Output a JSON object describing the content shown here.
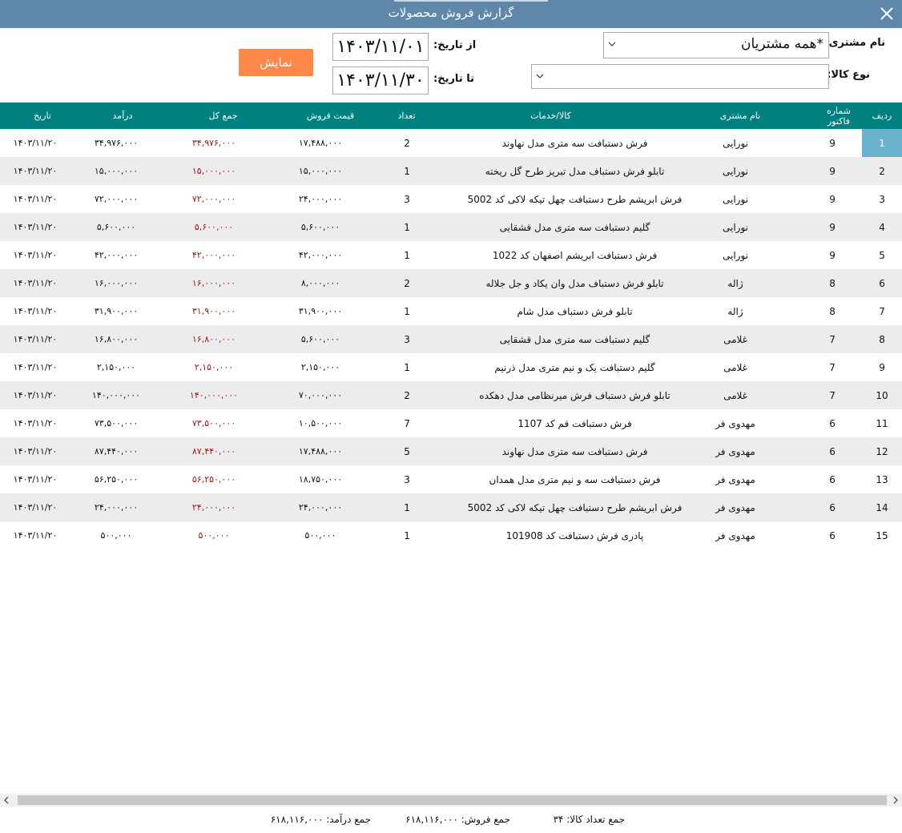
{
  "window": {
    "title": "گزارش فروش محصولات"
  },
  "filters": {
    "customer_label": "نام مشتری:",
    "customer_value": "*همه مشتریان",
    "product_type_label": "نوع کالا:",
    "product_type_value": "",
    "from_label": "از تاریخ:",
    "from_value": "۱۴۰۳/۱۱/۰۱",
    "to_label": "تا تاریخ:",
    "to_value": "۱۴۰۳/۱۱/۳۰",
    "show_button": "نمایش"
  },
  "columns": {
    "row": "ردیف",
    "invoice": "شماره فاکتور",
    "customer": "نام مشتری",
    "product": "کالا/خدمات",
    "qty": "تعداد",
    "price": "قیمت فروش",
    "total": "جمع کل",
    "income": "درآمد",
    "date": "تاریخ"
  },
  "rows": [
    {
      "row": "1",
      "invoice": "9",
      "customer": "نورایی",
      "product": "فرش دستبافت سه متری مدل نهاوند",
      "qty": "2",
      "price": "۱۷,۴۸۸,۰۰۰",
      "total": "۳۴,۹۷۶,۰۰۰",
      "income": "۳۴,۹۷۶,۰۰۰",
      "date": "۱۴۰۳/۱۱/۲۰"
    },
    {
      "row": "2",
      "invoice": "9",
      "customer": "نورایی",
      "product": "تابلو فرش دستباف مدل تبریز طرح گل ریخته",
      "qty": "1",
      "price": "۱۵,۰۰۰,۰۰۰",
      "total": "۱۵,۰۰۰,۰۰۰",
      "income": "۱۵,۰۰۰,۰۰۰",
      "date": "۱۴۰۳/۱۱/۲۰"
    },
    {
      "row": "3",
      "invoice": "9",
      "customer": "نورایی",
      "product": "فرش ابریشم طرح دستبافت چهل تیکه لاکی کد 5002",
      "qty": "3",
      "price": "۲۴,۰۰۰,۰۰۰",
      "total": "۷۲,۰۰۰,۰۰۰",
      "income": "۷۲,۰۰۰,۰۰۰",
      "date": "۱۴۰۳/۱۱/۲۰"
    },
    {
      "row": "4",
      "invoice": "9",
      "customer": "نورایی",
      "product": "گلیم دستبافت سه متری مدل قشقایی",
      "qty": "1",
      "price": "۵,۶۰۰,۰۰۰",
      "total": "۵,۶۰۰,۰۰۰",
      "income": "۵,۶۰۰,۰۰۰",
      "date": "۱۴۰۳/۱۱/۲۰"
    },
    {
      "row": "5",
      "invoice": "9",
      "customer": "نورایی",
      "product": "فرش دستبافت ابریشم اصفهان کد 1022",
      "qty": "1",
      "price": "۴۲,۰۰۰,۰۰۰",
      "total": "۴۲,۰۰۰,۰۰۰",
      "income": "۴۲,۰۰۰,۰۰۰",
      "date": "۱۴۰۳/۱۱/۲۰"
    },
    {
      "row": "6",
      "invoice": "8",
      "customer": "ژاله",
      "product": "تابلو فرش دستباف مدل وان یکاد و جل جلاله",
      "qty": "2",
      "price": "۸,۰۰۰,۰۰۰",
      "total": "۱۶,۰۰۰,۰۰۰",
      "income": "۱۶,۰۰۰,۰۰۰",
      "date": "۱۴۰۳/۱۱/۲۰"
    },
    {
      "row": "7",
      "invoice": "8",
      "customer": "ژاله",
      "product": "تابلو فرش دستباف مدل شام",
      "qty": "1",
      "price": "۳۱,۹۰۰,۰۰۰",
      "total": "۳۱,۹۰۰,۰۰۰",
      "income": "۳۱,۹۰۰,۰۰۰",
      "date": "۱۴۰۳/۱۱/۲۰"
    },
    {
      "row": "8",
      "invoice": "7",
      "customer": "غلامی",
      "product": "گلیم دستبافت سه متری مدل قشقایی",
      "qty": "3",
      "price": "۵,۶۰۰,۰۰۰",
      "total": "۱۶,۸۰۰,۰۰۰",
      "income": "۱۶,۸۰۰,۰۰۰",
      "date": "۱۴۰۳/۱۱/۲۰"
    },
    {
      "row": "9",
      "invoice": "7",
      "customer": "غلامی",
      "product": "گلیم دستبافت یک و نیم متری مدل ذرنیم",
      "qty": "1",
      "price": "۲,۱۵۰,۰۰۰",
      "total": "۲,۱۵۰,۰۰۰",
      "income": "۲,۱۵۰,۰۰۰",
      "date": "۱۴۰۳/۱۱/۲۰"
    },
    {
      "row": "10",
      "invoice": "7",
      "customer": "غلامی",
      "product": "تابلو فرش دستباف فرش میرنظامی مدل دهکده",
      "qty": "2",
      "price": "۷۰,۰۰۰,۰۰۰",
      "total": "۱۴۰,۰۰۰,۰۰۰",
      "income": "۱۴۰,۰۰۰,۰۰۰",
      "date": "۱۴۰۳/۱۱/۲۰"
    },
    {
      "row": "11",
      "invoice": "6",
      "customer": "مهدوی فر",
      "product": "فرش دستبافت قم کد 1107",
      "qty": "7",
      "price": "۱۰,۵۰۰,۰۰۰",
      "total": "۷۳,۵۰۰,۰۰۰",
      "income": "۷۳,۵۰۰,۰۰۰",
      "date": "۱۴۰۳/۱۱/۲۰"
    },
    {
      "row": "12",
      "invoice": "6",
      "customer": "مهدوی فر",
      "product": "فرش دستبافت سه متری مدل نهاوند",
      "qty": "5",
      "price": "۱۷,۴۸۸,۰۰۰",
      "total": "۸۷,۴۴۰,۰۰۰",
      "income": "۸۷,۴۴۰,۰۰۰",
      "date": "۱۴۰۳/۱۱/۲۰"
    },
    {
      "row": "13",
      "invoice": "6",
      "customer": "مهدوی فر",
      "product": "فرش دستبافت سه و نیم متری مدل همدان",
      "qty": "3",
      "price": "۱۸,۷۵۰,۰۰۰",
      "total": "۵۶,۲۵۰,۰۰۰",
      "income": "۵۶,۲۵۰,۰۰۰",
      "date": "۱۴۰۳/۱۱/۲۰"
    },
    {
      "row": "14",
      "invoice": "6",
      "customer": "مهدوی فر",
      "product": "فرش ابریشم طرح دستبافت چهل تیکه لاکی کد 5002",
      "qty": "1",
      "price": "۲۴,۰۰۰,۰۰۰",
      "total": "۲۴,۰۰۰,۰۰۰",
      "income": "۲۴,۰۰۰,۰۰۰",
      "date": "۱۴۰۳/۱۱/۲۰"
    },
    {
      "row": "15",
      "invoice": "6",
      "customer": "مهدوی فر",
      "product": "پادری فرش دستبافت کد 101908",
      "qty": "1",
      "price": "۵۰۰,۰۰۰",
      "total": "۵۰۰,۰۰۰",
      "income": "۵۰۰,۰۰۰",
      "date": "۱۴۰۳/۱۱/۲۰"
    }
  ],
  "totals": {
    "qty": "جمع تعداد کالا: ۳۴",
    "sales": "جمع فروش: ۶۱۸,۱۱۶,۰۰۰",
    "income": "جمع درآمد: ۶۱۸,۱۱۶,۰۰۰"
  },
  "colors": {
    "titlebar": "#5f87a9",
    "header": "#008080",
    "button": "#ff8848",
    "selected": "#6ab2cc",
    "total_text": "#a01818"
  }
}
